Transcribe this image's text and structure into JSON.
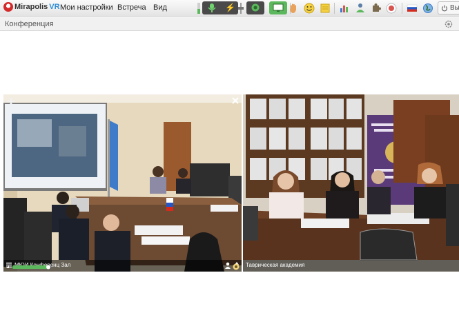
{
  "app": {
    "logo_brand": "Mirapolis",
    "logo_suffix": "VR"
  },
  "menu": {
    "items": [
      "Мои настройки",
      "Встреча",
      "Вид"
    ]
  },
  "toolbar": {
    "exit_label": "Вы",
    "icons": [
      "mic-icon",
      "lightning-icon",
      "camera-icon",
      "screen-share-icon",
      "hand-icon",
      "smiley-icon",
      "notes-icon",
      "chart-icon",
      "users-icon",
      "puzzle-icon",
      "record-icon",
      "flag-russia-icon",
      "globe-icon",
      "power-icon"
    ]
  },
  "conference": {
    "title": "Конференция"
  },
  "videos": [
    {
      "name": "МЮИ Конференц Зал"
    },
    {
      "name": "Таврическая академия"
    }
  ],
  "colors": {
    "active_green": "#5cb85c",
    "dark_button": "#4a4a4a",
    "record_red": "#d9534f"
  }
}
